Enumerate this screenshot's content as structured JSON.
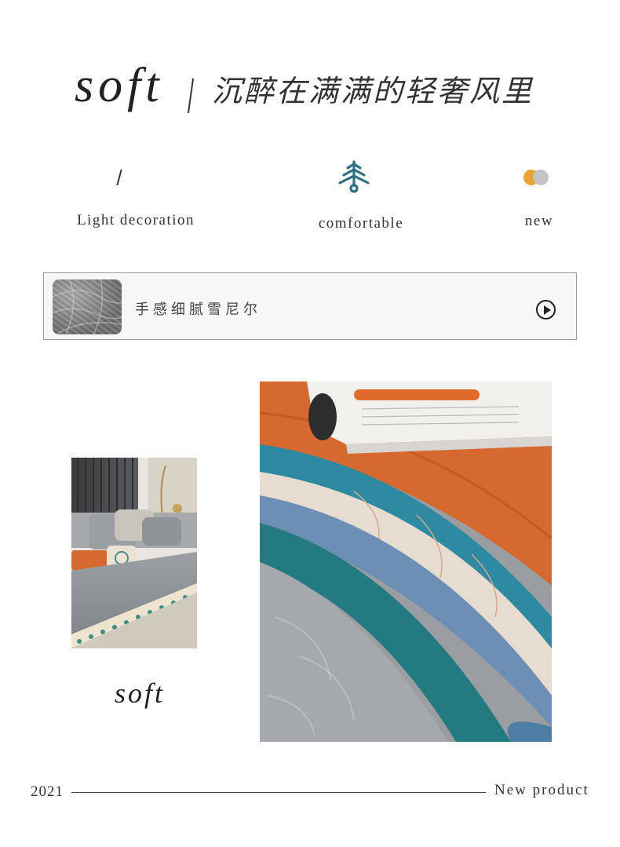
{
  "header": {
    "title_en": "soft",
    "title_cn": "沉醉在满满的轻奢风里"
  },
  "features": [
    {
      "label": "Light decoration",
      "icon": "slash-icon"
    },
    {
      "label": "comfortable",
      "icon": "tree-icon",
      "color": "#2e6f82"
    },
    {
      "label": "new",
      "icon": "dots-icon",
      "colors": [
        "#e8a533",
        "#c4c4c4"
      ]
    }
  ],
  "feature_bar": {
    "label": "手感细腻雪尼尔",
    "thumb": "fabric-thumbnail",
    "play_icon": "play-icon"
  },
  "gallery": {
    "left_photo": "sofa-photo",
    "right_photo": "chenille-fabric-photo",
    "caption": "soft"
  },
  "footer": {
    "year": "2021",
    "tag": "New product"
  }
}
